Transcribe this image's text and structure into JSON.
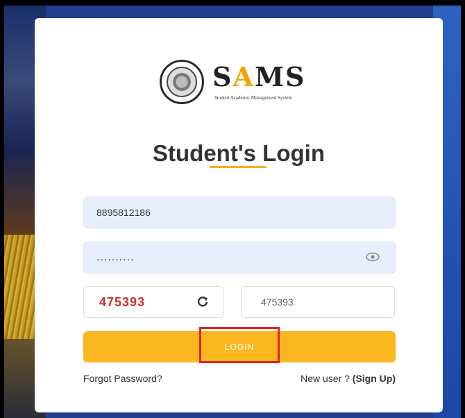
{
  "logo": {
    "word_prefix": "S",
    "word_highlight": "A",
    "word_suffix": "MS",
    "tagline": "Student Academic Management System"
  },
  "title": "Student's Login",
  "form": {
    "username_value": "8895812186",
    "password_value": "..........",
    "captcha_code": "475393",
    "captcha_input_value": "475393",
    "login_label": "LOGIN"
  },
  "links": {
    "forgot_password": "Forgot Password?",
    "new_user_prefix": "New user ? ",
    "signup_label": "(Sign Up)"
  },
  "colors": {
    "accent": "#fbb71f",
    "captcha_text": "#d1302b",
    "highlight_box": "#e81e1e",
    "input_bg": "#e8eefc"
  },
  "icons": [
    "state-emblem-icon",
    "eye-icon",
    "refresh-icon"
  ]
}
